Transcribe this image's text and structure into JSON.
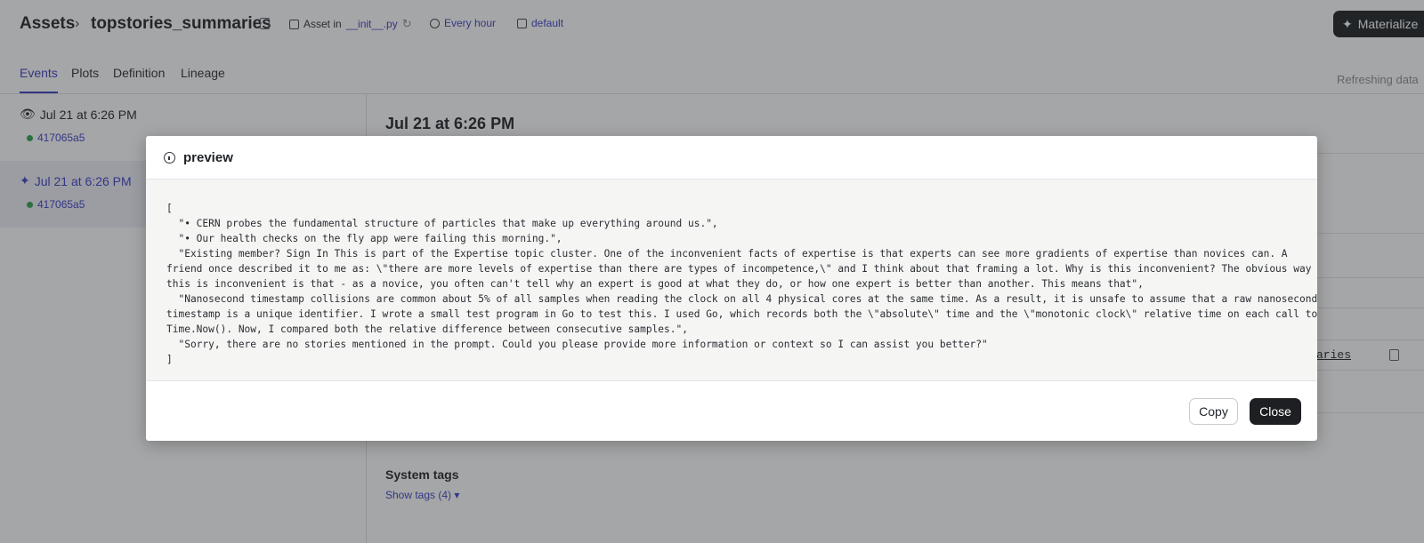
{
  "header": {
    "breadcrumb_root": "Assets",
    "asset_name": "topstories_summaries",
    "asset_in_label": "Asset in",
    "asset_in_file": "__init__.py",
    "schedule": "Every hour",
    "repo": "default",
    "materialize_label": "Materialize"
  },
  "tabs": [
    "Events",
    "Plots",
    "Definition",
    "Lineage"
  ],
  "refreshing_text": "Refreshing data",
  "events": [
    {
      "time": "Jul 21 at 6:26 PM",
      "run_id": "417065a5",
      "icon": "eye-icon"
    },
    {
      "time": "Jul 21 at 6:26 PM",
      "run_id": "417065a5",
      "icon": "sparkle-icon"
    }
  ],
  "main": {
    "title": "Jul 21 at 6:26 PM",
    "link_tail": "_summaries",
    "system_tags_label": "System tags",
    "show_tags_label": "Show tags (4)"
  },
  "modal": {
    "title": "preview",
    "lines": [
      "[",
      "  \"• CERN probes the fundamental structure of particles that make up everything around us.\",",
      "  \"• Our health checks on the fly app were failing this morning.\",",
      "  \"Existing member? Sign In This is part of the Expertise topic cluster. One of the inconvenient facts of expertise is that experts can see more gradients of expertise than novices can. A",
      "friend once described it to me as: \\\"there are more levels of expertise than there are types of incompetence,\\\" and I think about that framing a lot. Why is this inconvenient? The obvious way",
      "this is inconvenient is that - as a novice, you often can't tell why an expert is good at what they do, or how one expert is better than another. This means that\",",
      "  \"Nanosecond timestamp collisions are common about 5% of all samples when reading the clock on all 4 physical cores at the same time. As a result, it is unsafe to assume that a raw nanosecond",
      "timestamp is a unique identifier. I wrote a small test program in Go to test this. I used Go, which records both the \\\"absolute\\\" time and the \\\"monotonic clock\\\" relative time on each call to",
      "Time.Now(). Now, I compared both the relative difference between consecutive samples.\",",
      "  \"Sorry, there are no stories mentioned in the prompt. Could you please provide more information or context so I can assist you better?\"",
      "]"
    ],
    "copy_label": "Copy",
    "close_label": "Close"
  }
}
